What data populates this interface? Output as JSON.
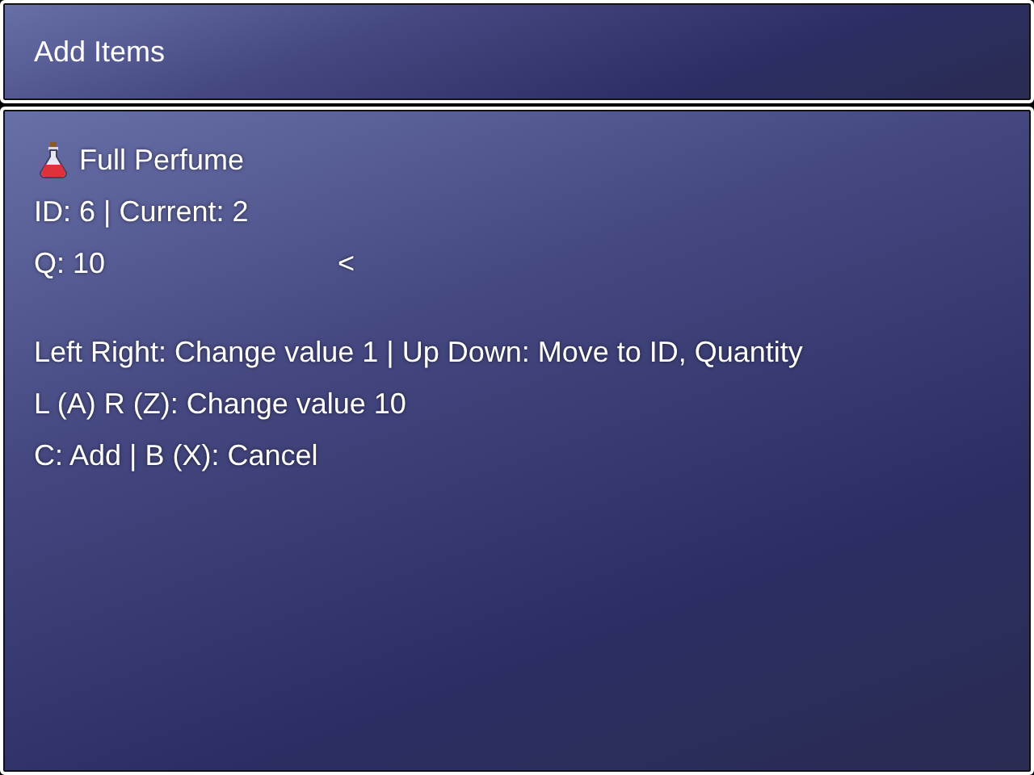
{
  "header": {
    "title": "Add Items"
  },
  "item": {
    "name": "Full Perfume"
  },
  "id_line": "ID: 6 | Current: 2",
  "quantity_line": {
    "text": "Q: 10",
    "cursor": "<"
  },
  "help_lines": [
    "Left Right: Change value 1 | Up Down: Move to ID, Quantity",
    "L (A) R (Z): Change value 10",
    "C: Add | B (X): Cancel"
  ]
}
